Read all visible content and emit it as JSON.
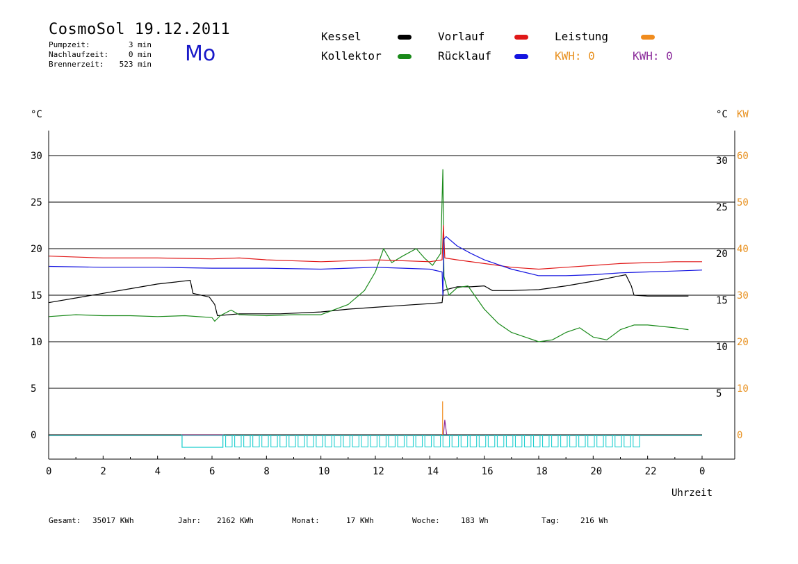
{
  "header": {
    "title": "CosmoSol 19.12.2011",
    "weekday": "Mo",
    "stats": [
      {
        "label": "Pumpzeit:",
        "value": "3 min"
      },
      {
        "label": "Nachlaufzeit:",
        "value": "0 min"
      },
      {
        "label": "Brennerzeit:",
        "value": "523 min"
      }
    ]
  },
  "legend": {
    "items": [
      {
        "label": "Kessel",
        "color": "#000000"
      },
      {
        "label": "Kollektor",
        "color": "#1a8a1a"
      },
      {
        "label": "Vorlauf",
        "color": "#e01818"
      },
      {
        "label": "Rücklauf",
        "color": "#1414e0"
      },
      {
        "label": "Leistung",
        "color": "#f08c1e"
      }
    ],
    "kwh_orange": "KWH: 0",
    "kwh_purple": "KWH: 0",
    "kwh_orange_color": "#e8901e",
    "kwh_purple_color": "#8a2a9a"
  },
  "axis_units": {
    "left": "°C",
    "right_temp": "°C",
    "right_power": "KW",
    "x": "Uhrzeit"
  },
  "totals": [
    {
      "label": "Gesamt:",
      "value": "35017 KWh"
    },
    {
      "label": "Jahr:",
      "value": "2162 KWh"
    },
    {
      "label": "Monat:",
      "value": "17 KWh"
    },
    {
      "label": "Woche:",
      "value": "183 Wh"
    },
    {
      "label": "Tag:",
      "value": "216 Wh"
    }
  ],
  "chart_data": {
    "type": "line",
    "xlabel": "Uhrzeit",
    "ylabel": "°C",
    "xlim": [
      0,
      24
    ],
    "ylim": [
      -2,
      32
    ],
    "x_tick_labels": [
      "0",
      "2",
      "4",
      "6",
      "8",
      "10",
      "12",
      "14",
      "16",
      "18",
      "20",
      "22",
      "0"
    ],
    "y_ticks": [
      0,
      5,
      10,
      15,
      20,
      25,
      30
    ],
    "y2_power_ticks": [
      0,
      10,
      20,
      30,
      40,
      50,
      60
    ],
    "grid": "horizontal",
    "series": [
      {
        "name": "Kessel",
        "color": "#000000",
        "x": [
          0,
          1,
          2,
          3,
          4,
          5.2,
          5.3,
          5.9,
          6.1,
          6.2,
          7,
          8.5,
          10,
          11,
          12,
          13,
          14,
          14.45,
          14.5,
          14.6,
          15,
          15.5,
          16,
          16.3,
          17,
          18,
          19,
          20,
          21.2,
          21.4,
          21.5,
          22,
          23,
          23.5
        ],
        "y": [
          14.2,
          14.7,
          15.2,
          15.7,
          16.2,
          16.6,
          15.2,
          14.8,
          14.0,
          12.8,
          13.0,
          13.0,
          13.2,
          13.5,
          13.7,
          13.9,
          14.1,
          14.2,
          15.5,
          15.6,
          15.9,
          15.9,
          16.0,
          15.5,
          15.5,
          15.6,
          16.0,
          16.5,
          17.2,
          16.0,
          15.0,
          14.9,
          14.9,
          14.9
        ]
      },
      {
        "name": "Kollektor",
        "color": "#1a8a1a",
        "x": [
          0,
          1,
          2,
          3,
          4,
          5,
          6,
          6.1,
          6.3,
          6.7,
          7,
          8,
          9,
          10,
          11,
          11.6,
          12,
          12.3,
          12.6,
          13,
          13.5,
          13.8,
          14.1,
          14.4,
          14.48,
          14.52,
          14.7,
          15,
          15.4,
          16,
          16.5,
          17,
          18,
          18.5,
          19,
          19.5,
          20,
          20.5,
          21,
          21.5,
          22,
          23,
          23.5
        ],
        "y": [
          12.7,
          12.9,
          12.8,
          12.8,
          12.7,
          12.8,
          12.6,
          12.2,
          12.8,
          13.4,
          12.9,
          12.8,
          12.9,
          12.9,
          14.0,
          15.5,
          17.5,
          20.0,
          18.5,
          19.2,
          20.0,
          19.0,
          18.2,
          19.5,
          28.5,
          17.0,
          15.0,
          15.8,
          16.0,
          13.5,
          12.0,
          11.0,
          10.0,
          10.2,
          11.0,
          11.5,
          10.5,
          10.2,
          11.3,
          11.8,
          11.8,
          11.5,
          11.3
        ]
      },
      {
        "name": "Vorlauf",
        "color": "#e01818",
        "x": [
          0,
          2,
          4,
          6,
          7,
          8,
          10,
          12,
          13,
          14,
          14.45,
          14.5,
          14.55,
          15,
          16,
          17,
          18,
          19,
          20,
          21,
          22,
          23,
          24
        ],
        "y": [
          19.2,
          19.0,
          19.0,
          18.9,
          19.0,
          18.8,
          18.6,
          18.8,
          18.7,
          18.6,
          18.8,
          22.5,
          19.0,
          18.8,
          18.4,
          18.0,
          17.8,
          18.0,
          18.2,
          18.4,
          18.5,
          18.6,
          18.6
        ]
      },
      {
        "name": "Rücklauf",
        "color": "#1414e0",
        "x": [
          0,
          2,
          4,
          6,
          8,
          10,
          12,
          13,
          14,
          14.45,
          14.48,
          14.52,
          14.6,
          15,
          15.5,
          16,
          17,
          18,
          19,
          20,
          21,
          22,
          23,
          24
        ],
        "y": [
          18.1,
          18.0,
          18.0,
          17.9,
          17.9,
          17.8,
          18.0,
          17.9,
          17.8,
          17.5,
          15.0,
          21.0,
          21.3,
          20.3,
          19.5,
          18.8,
          17.8,
          17.1,
          17.1,
          17.2,
          17.4,
          17.5,
          17.6,
          17.7
        ]
      }
    ],
    "pump_on_intervals": [
      [
        4.9,
        6.4
      ]
    ],
    "burner_cycles": {
      "start": 6.5,
      "end": 21.8,
      "count": 46,
      "baseline": 0,
      "top": -1.3
    }
  }
}
